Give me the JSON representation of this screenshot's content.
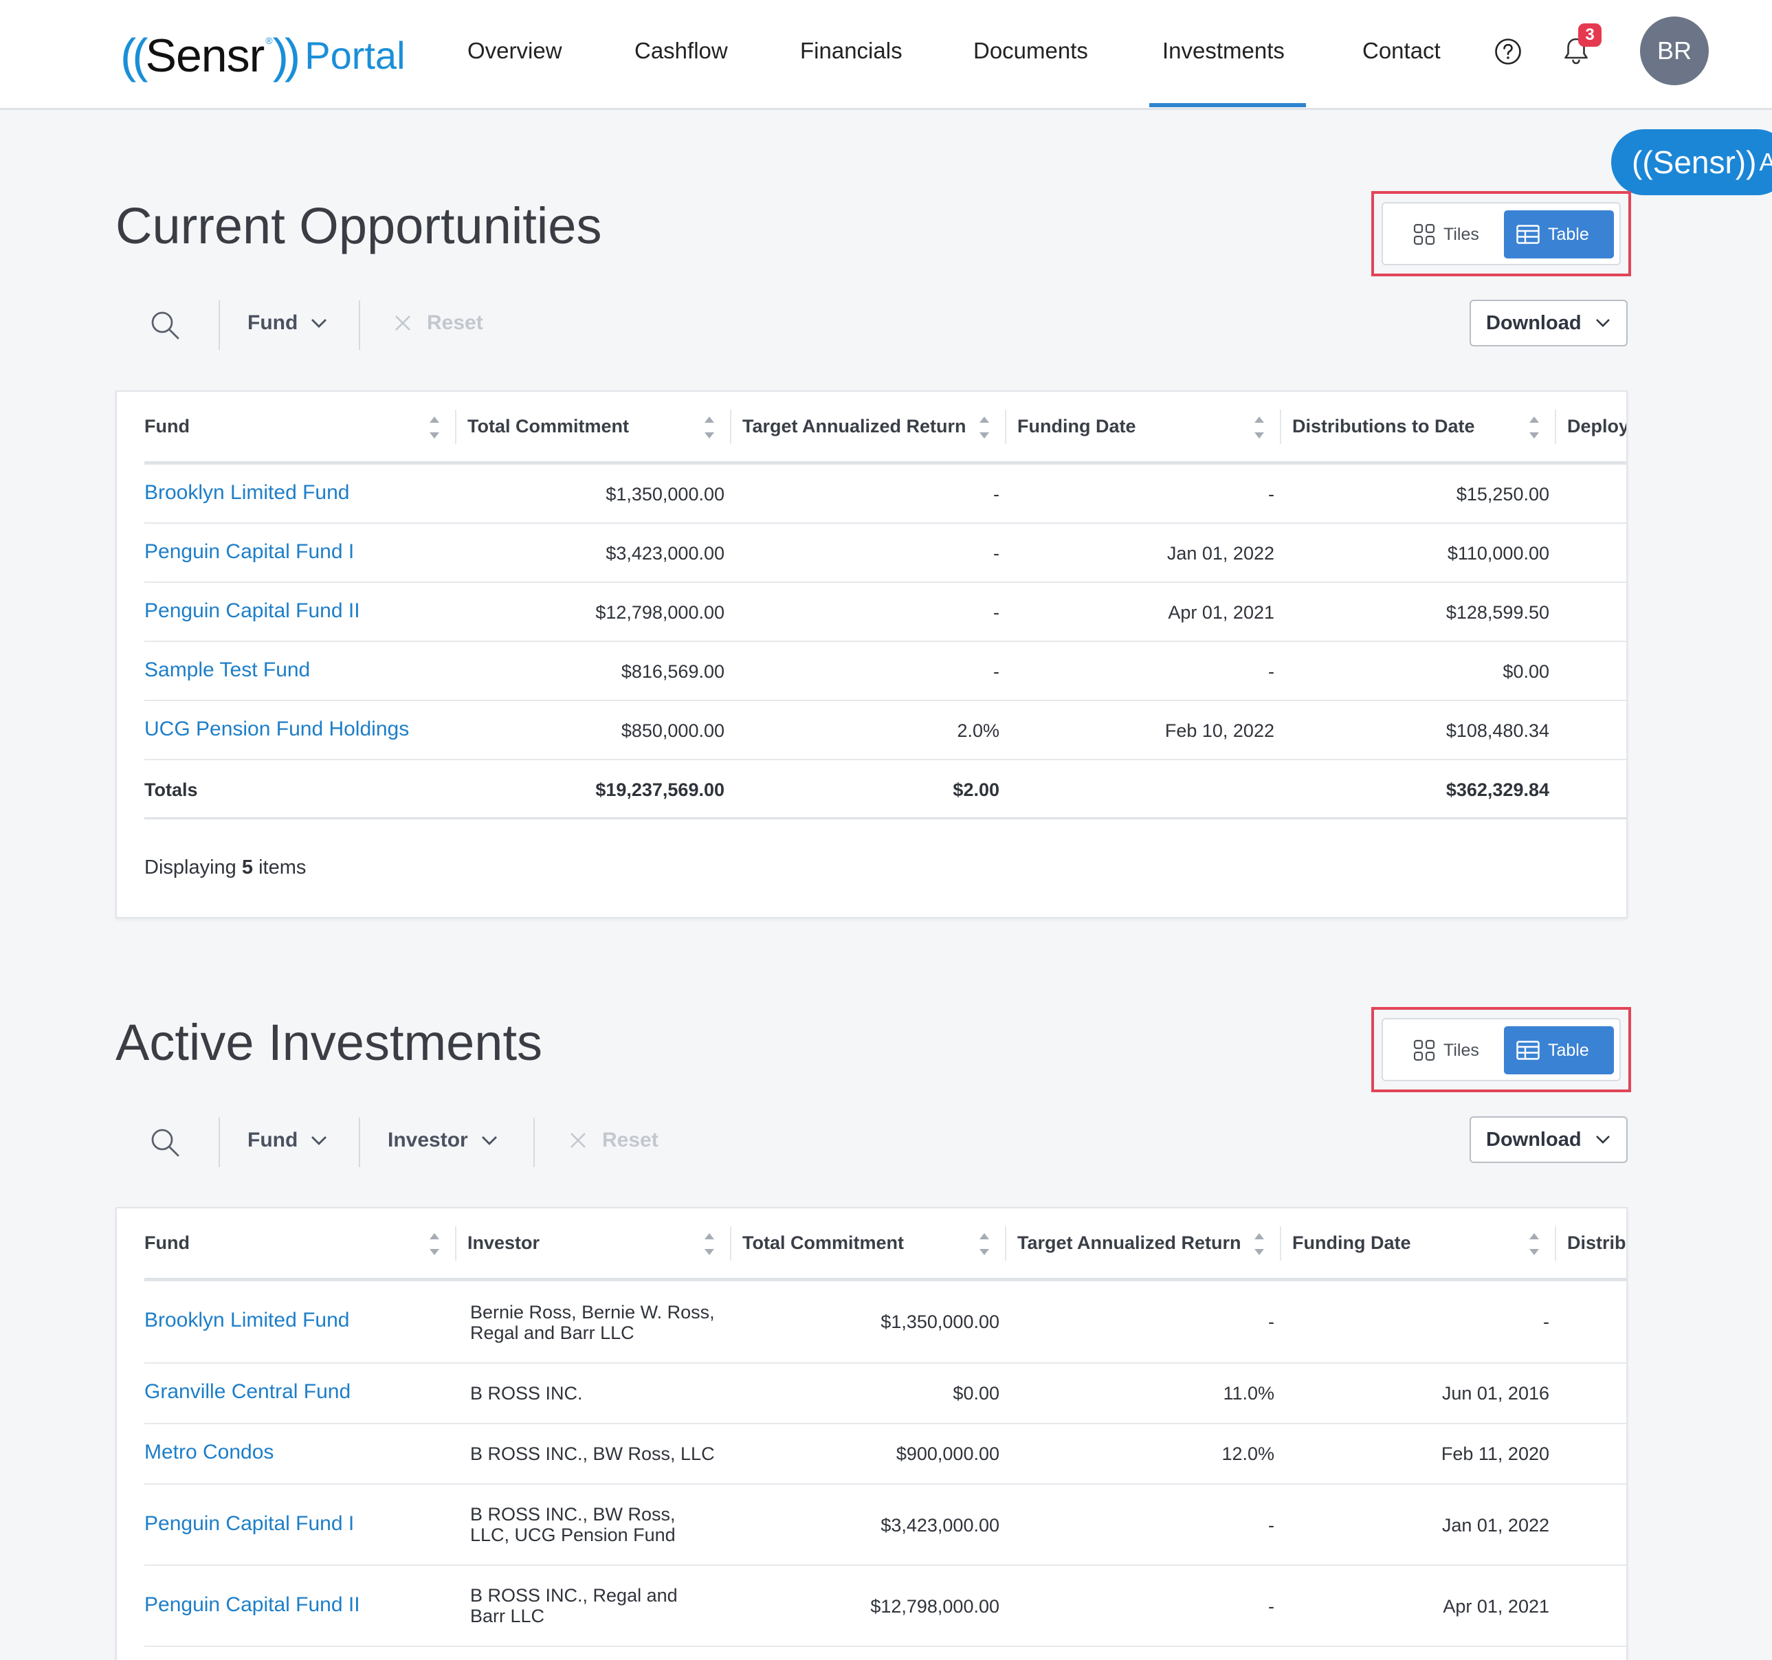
{
  "header": {
    "logo": {
      "open": "((",
      "brand": "Sensr",
      "reg": "®",
      "close": "))",
      "portal": "Portal"
    },
    "nav": [
      "Overview",
      "Cashflow",
      "Financials",
      "Documents",
      "Investments",
      "Contact"
    ],
    "active_nav": "Investments",
    "notification_count": "3",
    "avatar_initials": "BR"
  },
  "ai_button": {
    "logo": "((Sensr))",
    "label": "AI"
  },
  "colors": {
    "accent": "#3a82d4",
    "link": "#1d7ec8",
    "highlight_outline": "#e24459",
    "badge": "#e53950"
  },
  "view_toggle": {
    "tiles_label": "Tiles",
    "table_label": "Table",
    "selected": "Table"
  },
  "filters": {
    "fund_label": "Fund",
    "investor_label": "Investor",
    "reset_label": "Reset",
    "download_label": "Download"
  },
  "current_opportunities": {
    "title": "Current Opportunities",
    "columns": [
      "Fund",
      "Total Commitment",
      "Target Annualized Return",
      "Funding Date",
      "Distributions to Date",
      "Deploy"
    ],
    "rows": [
      {
        "fund": "Brooklyn Limited Fund",
        "commitment": "$1,350,000.00",
        "target": "-",
        "funding_date": "-",
        "distributions": "$15,250.00"
      },
      {
        "fund": "Penguin Capital Fund I",
        "commitment": "$3,423,000.00",
        "target": "-",
        "funding_date": "Jan 01, 2022",
        "distributions": "$110,000.00"
      },
      {
        "fund": "Penguin Capital Fund II",
        "commitment": "$12,798,000.00",
        "target": "-",
        "funding_date": "Apr 01, 2021",
        "distributions": "$128,599.50"
      },
      {
        "fund": "Sample Test Fund",
        "commitment": "$816,569.00",
        "target": "-",
        "funding_date": "-",
        "distributions": "$0.00"
      },
      {
        "fund": "UCG Pension Fund Holdings",
        "commitment": "$850,000.00",
        "target": "2.0%",
        "funding_date": "Feb 10, 2022",
        "distributions": "$108,480.34"
      }
    ],
    "totals": {
      "label": "Totals",
      "commitment": "$19,237,569.00",
      "target": "$2.00",
      "distributions": "$362,329.84"
    },
    "display": {
      "prefix": "Displaying",
      "count": "5",
      "suffix": "items"
    }
  },
  "active_investments": {
    "title": "Active Investments",
    "columns": [
      "Fund",
      "Investor",
      "Total Commitment",
      "Target Annualized Return",
      "Funding Date",
      "Distrib"
    ],
    "rows": [
      {
        "fund": "Brooklyn Limited Fund",
        "investor": "Bernie Ross, Bernie W. Ross, Regal and Barr LLC",
        "commitment": "$1,350,000.00",
        "target": "-",
        "funding_date": "-"
      },
      {
        "fund": "Granville Central Fund",
        "investor": "B ROSS INC.",
        "commitment": "$0.00",
        "target": "11.0%",
        "funding_date": "Jun 01, 2016"
      },
      {
        "fund": "Metro Condos",
        "investor": "B ROSS INC., BW Ross, LLC",
        "commitment": "$900,000.00",
        "target": "12.0%",
        "funding_date": "Feb 11, 2020"
      },
      {
        "fund": "Penguin Capital Fund I",
        "investor": "B ROSS INC., BW Ross, LLC, UCG Pension Fund",
        "commitment": "$3,423,000.00",
        "target": "-",
        "funding_date": "Jan 01, 2022"
      },
      {
        "fund": "Penguin Capital Fund II",
        "investor": "B ROSS INC., Regal and Barr LLC",
        "commitment": "$12,798,000.00",
        "target": "-",
        "funding_date": "Apr 01, 2021"
      }
    ]
  }
}
